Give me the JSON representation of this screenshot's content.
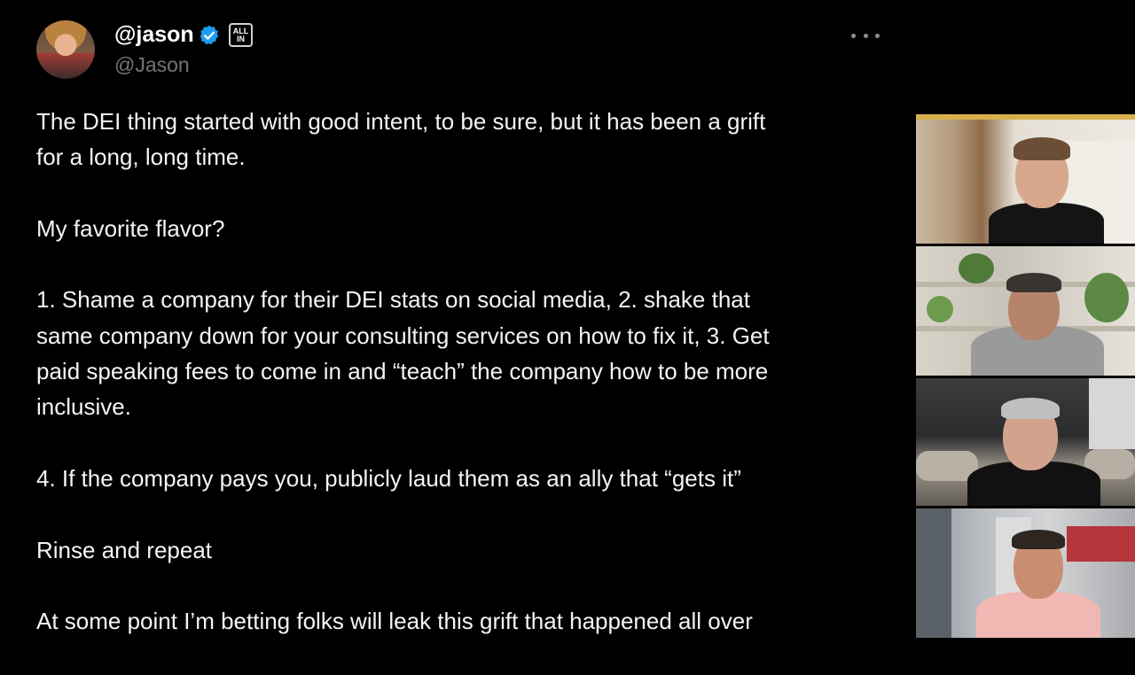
{
  "tweet": {
    "display_name": "@jason",
    "handle": "@Jason",
    "badge": "ALL IN",
    "paragraphs": [
      "The DEI thing started with good intent, to be sure, but it has been a grift\nfor a long, long time.",
      "My favorite flavor?",
      "1. Shame a company for their DEI stats on social media, 2.  shake that\nsame company down for your consulting services on how to fix it, 3. Get\npaid speaking fees to come in and “teach” the company how to be more\ninclusive.",
      "4. If the company pays you, publicly laud them as an ally that “gets it”",
      "Rinse and repeat",
      "At some point I’m betting folks will leak this grift that happened all over"
    ]
  },
  "icons": {
    "verified": "verified-check-icon",
    "more": "more-horizontal-icon"
  },
  "colors": {
    "background": "#000000",
    "text": "#e7e9ea",
    "handle": "#71767b",
    "verified": "#1d9bf0"
  }
}
